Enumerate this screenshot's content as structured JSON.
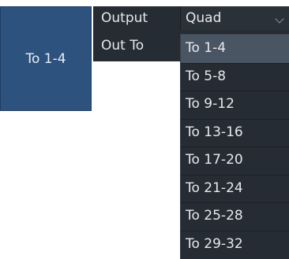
{
  "tile": {
    "label": "To 1-4"
  },
  "properties": {
    "output": {
      "label": "Output",
      "value": "Quad"
    },
    "out_to": {
      "label": "Out To",
      "value": "To 1-4"
    }
  },
  "dropdown": {
    "selected_index": 0,
    "options": [
      "To 1-4",
      "To 5-8",
      "To 9-12",
      "To 13-16",
      "To 17-20",
      "To 21-24",
      "To 25-28",
      "To 29-32"
    ]
  },
  "colors": {
    "tile_bg": "#2d527e",
    "panel_bg": "#262c33",
    "selected_bg": "#4a5563",
    "text": "#e6e9ee"
  },
  "icons": {
    "dropdown": "chevron-down-icon"
  }
}
